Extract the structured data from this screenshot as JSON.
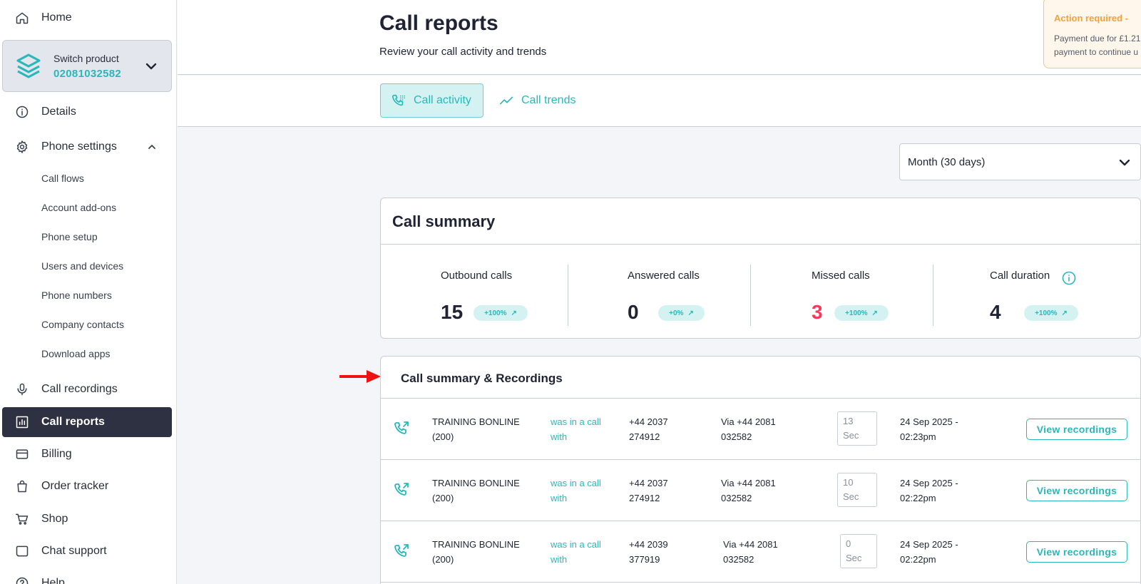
{
  "sidebar": {
    "home": "Home",
    "switch": {
      "label": "Switch product",
      "number": "02081032582"
    },
    "details": "Details",
    "phone_settings": "Phone settings",
    "sub_items": [
      "Call flows",
      "Account add-ons",
      "Phone setup",
      "Users and devices",
      "Phone numbers",
      "Company contacts",
      "Download apps"
    ],
    "call_recordings": "Call recordings",
    "call_reports": "Call reports",
    "billing": "Billing",
    "order_tracker": "Order tracker",
    "shop": "Shop",
    "chat_support": "Chat support",
    "help": "Help"
  },
  "header": {
    "title": "Call reports",
    "subtitle": "Review your call activity and trends"
  },
  "alert": {
    "title": "Action required - ",
    "line1": "Payment due for £1.21",
    "line2": "payment to continue u"
  },
  "tabs": {
    "activity": "Call activity",
    "trends": "Call trends"
  },
  "period": {
    "selected": "Month (30 days)"
  },
  "summary": {
    "title": "Call summary",
    "stats": [
      {
        "label": "Outbound calls",
        "value": "15",
        "change": "+100%"
      },
      {
        "label": "Answered calls",
        "value": "0",
        "change": "+0%"
      },
      {
        "label": "Missed calls",
        "value": "3",
        "change": "+100%"
      },
      {
        "label": "Call duration",
        "value": "4",
        "change": "+100%"
      }
    ]
  },
  "recordings": {
    "title": "Call summary & Recordings",
    "button_label": "View recordings",
    "rows": [
      {
        "name1": "TRAINING BONLINE",
        "name2": "(200)",
        "action1": "was in a call",
        "action2": "with",
        "num1": "+44 2037",
        "num2": "274912",
        "via1": "Via +44 2081",
        "via2": "032582",
        "dur1": "13",
        "dur2": "Sec",
        "date1": "24 Sep 2025 -",
        "date2": "02:23pm"
      },
      {
        "name1": "TRAINING BONLINE",
        "name2": "(200)",
        "action1": "was in a call",
        "action2": "with",
        "num1": "+44 2037",
        "num2": "274912",
        "via1": "Via +44 2081",
        "via2": "032582",
        "dur1": "10",
        "dur2": "Sec",
        "date1": "24 Sep 2025 -",
        "date2": "02:22pm"
      },
      {
        "name1": "TRAINING BONLINE",
        "name2": "(200)",
        "action1": "was in a call",
        "action2": "with",
        "num1": "+44 2039",
        "num2": "377919",
        "via1": "Via +44 2081",
        "via2": "032582",
        "dur1": "0",
        "dur2": "Sec",
        "date1": "24 Sep 2025 -",
        "date2": "02:22pm"
      }
    ]
  },
  "colors": {
    "accent": "#2ab7b9",
    "active_nav": "#2e3142",
    "missed": "#f23a5b",
    "alert": "#f2a03a"
  }
}
